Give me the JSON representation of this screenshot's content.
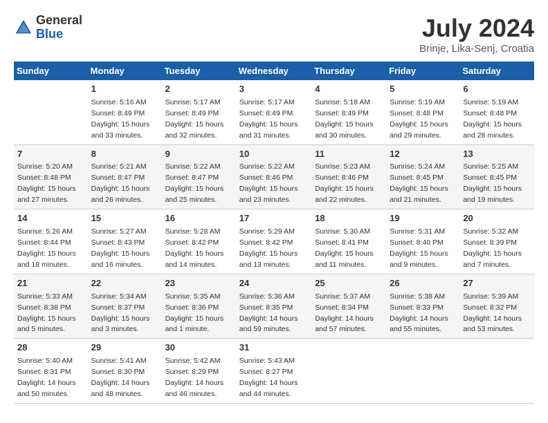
{
  "header": {
    "logo_general": "General",
    "logo_blue": "Blue",
    "month_title": "July 2024",
    "location": "Brinje, Lika-Senj, Croatia"
  },
  "days_of_week": [
    "Sunday",
    "Monday",
    "Tuesday",
    "Wednesday",
    "Thursday",
    "Friday",
    "Saturday"
  ],
  "weeks": [
    [
      {
        "day": "",
        "info": ""
      },
      {
        "day": "1",
        "info": "Sunrise: 5:16 AM\nSunset: 8:49 PM\nDaylight: 15 hours\nand 33 minutes."
      },
      {
        "day": "2",
        "info": "Sunrise: 5:17 AM\nSunset: 8:49 PM\nDaylight: 15 hours\nand 32 minutes."
      },
      {
        "day": "3",
        "info": "Sunrise: 5:17 AM\nSunset: 8:49 PM\nDaylight: 15 hours\nand 31 minutes."
      },
      {
        "day": "4",
        "info": "Sunrise: 5:18 AM\nSunset: 8:49 PM\nDaylight: 15 hours\nand 30 minutes."
      },
      {
        "day": "5",
        "info": "Sunrise: 5:19 AM\nSunset: 8:48 PM\nDaylight: 15 hours\nand 29 minutes."
      },
      {
        "day": "6",
        "info": "Sunrise: 5:19 AM\nSunset: 8:48 PM\nDaylight: 15 hours\nand 28 minutes."
      }
    ],
    [
      {
        "day": "7",
        "info": "Sunrise: 5:20 AM\nSunset: 8:48 PM\nDaylight: 15 hours\nand 27 minutes."
      },
      {
        "day": "8",
        "info": "Sunrise: 5:21 AM\nSunset: 8:47 PM\nDaylight: 15 hours\nand 26 minutes."
      },
      {
        "day": "9",
        "info": "Sunrise: 5:22 AM\nSunset: 8:47 PM\nDaylight: 15 hours\nand 25 minutes."
      },
      {
        "day": "10",
        "info": "Sunrise: 5:22 AM\nSunset: 8:46 PM\nDaylight: 15 hours\nand 23 minutes."
      },
      {
        "day": "11",
        "info": "Sunrise: 5:23 AM\nSunset: 8:46 PM\nDaylight: 15 hours\nand 22 minutes."
      },
      {
        "day": "12",
        "info": "Sunrise: 5:24 AM\nSunset: 8:45 PM\nDaylight: 15 hours\nand 21 minutes."
      },
      {
        "day": "13",
        "info": "Sunrise: 5:25 AM\nSunset: 8:45 PM\nDaylight: 15 hours\nand 19 minutes."
      }
    ],
    [
      {
        "day": "14",
        "info": "Sunrise: 5:26 AM\nSunset: 8:44 PM\nDaylight: 15 hours\nand 18 minutes."
      },
      {
        "day": "15",
        "info": "Sunrise: 5:27 AM\nSunset: 8:43 PM\nDaylight: 15 hours\nand 16 minutes."
      },
      {
        "day": "16",
        "info": "Sunrise: 5:28 AM\nSunset: 8:42 PM\nDaylight: 15 hours\nand 14 minutes."
      },
      {
        "day": "17",
        "info": "Sunrise: 5:29 AM\nSunset: 8:42 PM\nDaylight: 15 hours\nand 13 minutes."
      },
      {
        "day": "18",
        "info": "Sunrise: 5:30 AM\nSunset: 8:41 PM\nDaylight: 15 hours\nand 11 minutes."
      },
      {
        "day": "19",
        "info": "Sunrise: 5:31 AM\nSunset: 8:40 PM\nDaylight: 15 hours\nand 9 minutes."
      },
      {
        "day": "20",
        "info": "Sunrise: 5:32 AM\nSunset: 8:39 PM\nDaylight: 15 hours\nand 7 minutes."
      }
    ],
    [
      {
        "day": "21",
        "info": "Sunrise: 5:33 AM\nSunset: 8:38 PM\nDaylight: 15 hours\nand 5 minutes."
      },
      {
        "day": "22",
        "info": "Sunrise: 5:34 AM\nSunset: 8:37 PM\nDaylight: 15 hours\nand 3 minutes."
      },
      {
        "day": "23",
        "info": "Sunrise: 5:35 AM\nSunset: 8:36 PM\nDaylight: 15 hours\nand 1 minute."
      },
      {
        "day": "24",
        "info": "Sunrise: 5:36 AM\nSunset: 8:35 PM\nDaylight: 14 hours\nand 59 minutes."
      },
      {
        "day": "25",
        "info": "Sunrise: 5:37 AM\nSunset: 8:34 PM\nDaylight: 14 hours\nand 57 minutes."
      },
      {
        "day": "26",
        "info": "Sunrise: 5:38 AM\nSunset: 8:33 PM\nDaylight: 14 hours\nand 55 minutes."
      },
      {
        "day": "27",
        "info": "Sunrise: 5:39 AM\nSunset: 8:32 PM\nDaylight: 14 hours\nand 53 minutes."
      }
    ],
    [
      {
        "day": "28",
        "info": "Sunrise: 5:40 AM\nSunset: 8:31 PM\nDaylight: 14 hours\nand 50 minutes."
      },
      {
        "day": "29",
        "info": "Sunrise: 5:41 AM\nSunset: 8:30 PM\nDaylight: 14 hours\nand 48 minutes."
      },
      {
        "day": "30",
        "info": "Sunrise: 5:42 AM\nSunset: 8:29 PM\nDaylight: 14 hours\nand 46 minutes."
      },
      {
        "day": "31",
        "info": "Sunrise: 5:43 AM\nSunset: 8:27 PM\nDaylight: 14 hours\nand 44 minutes."
      },
      {
        "day": "",
        "info": ""
      },
      {
        "day": "",
        "info": ""
      },
      {
        "day": "",
        "info": ""
      }
    ]
  ]
}
